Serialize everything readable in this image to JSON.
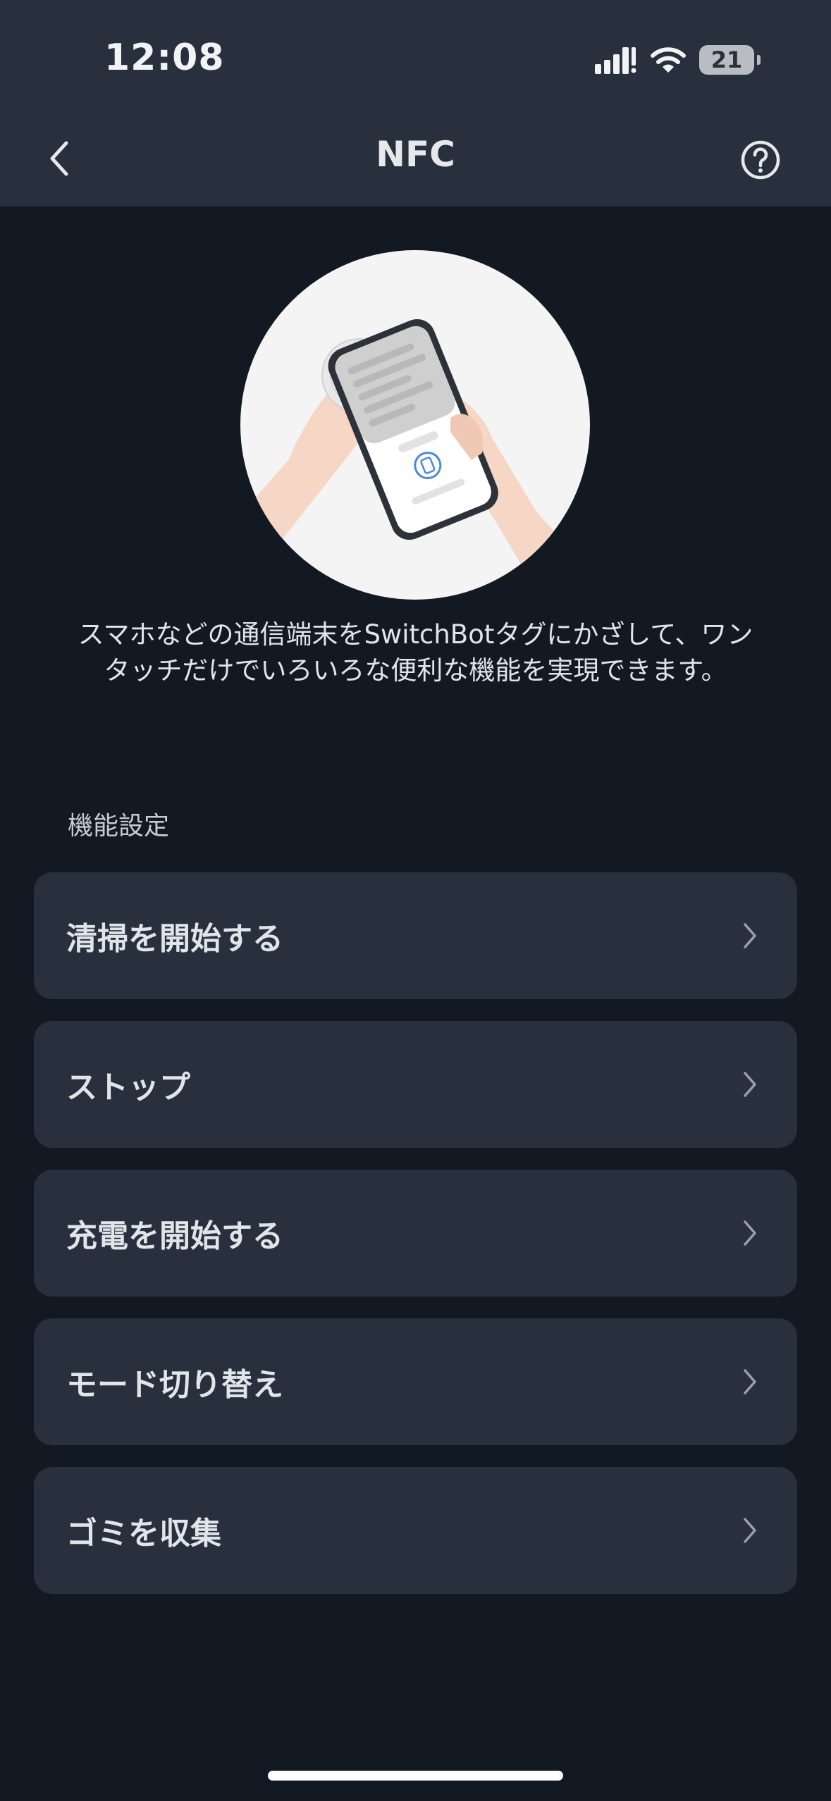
{
  "status_bar": {
    "time": "12:08",
    "battery": "21",
    "icons": [
      "cellular-signal-icon",
      "wifi-icon",
      "battery-icon"
    ]
  },
  "nav": {
    "title": "NFC",
    "back_icon": "chevron-left-icon",
    "help_icon": "help-circle-icon"
  },
  "hero": {
    "illustration": "hand-tapping-phone-on-nfc-tag-illustration"
  },
  "description": "スマホなどの通信端末をSwitchBotタグにかざして、ワンタッチだけでいろいろな便利な機能を実現できます。",
  "section": {
    "label": "機能設定"
  },
  "items": [
    {
      "label": "清掃を開始する"
    },
    {
      "label": "ストップ"
    },
    {
      "label": "充電を開始する"
    },
    {
      "label": "モード切り替え"
    },
    {
      "label": "ゴミを収集"
    }
  ],
  "colors": {
    "background": "#131923",
    "surface": "#282f3d",
    "text": "#e1e4e9",
    "muted": "#9aa0aa"
  }
}
